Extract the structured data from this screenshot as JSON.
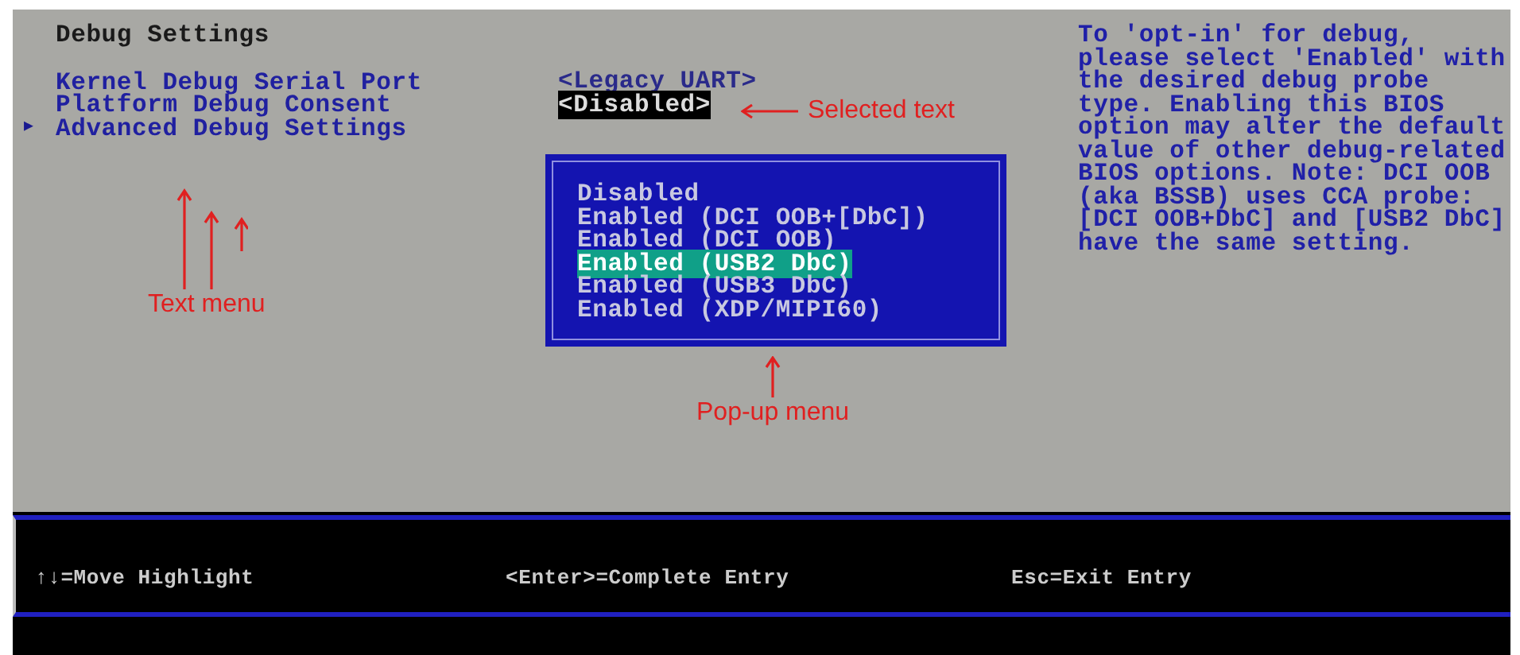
{
  "page": {
    "title": "Debug Settings"
  },
  "menu_items": [
    {
      "label": "Kernel Debug Serial Port"
    },
    {
      "label": "Platform Debug Consent"
    },
    {
      "label": "Advanced Debug Settings",
      "marker": "▶"
    }
  ],
  "values": [
    {
      "text": "<Legacy UART>",
      "selected": false
    },
    {
      "text": "<Disabled>",
      "selected": true
    }
  ],
  "popup": {
    "options": [
      {
        "label": "Disabled",
        "selected": false
      },
      {
        "label": "Enabled (DCI OOB+[DbC])",
        "selected": false
      },
      {
        "label": "Enabled (DCI OOB)",
        "selected": false
      },
      {
        "label": "Enabled (USB2 DbC)",
        "selected": true
      },
      {
        "label": "Enabled (USB3 DbC)",
        "selected": false
      },
      {
        "label": "Enabled (XDP/MIPI60)",
        "selected": false
      }
    ]
  },
  "help_text": "To 'opt-in' for debug,\nplease select 'Enabled' with\nthe desired debug probe\ntype. Enabling this BIOS\noption may alter the default\nvalue of other debug-related\nBIOS options. Note: DCI OOB\n(aka BSSB) uses CCA probe:\n[DCI OOB+DbC] and [USB2 DbC]\nhave the same setting.",
  "footer": {
    "hints": [
      "↑↓=Move Highlight",
      "<Enter>=Complete Entry",
      "Esc=Exit Entry"
    ]
  },
  "annotations": [
    {
      "kind": "triple-up",
      "text": "Text menu"
    },
    {
      "kind": "left",
      "text": "Selected text"
    },
    {
      "kind": "up",
      "text": "Pop-up menu"
    }
  ]
}
